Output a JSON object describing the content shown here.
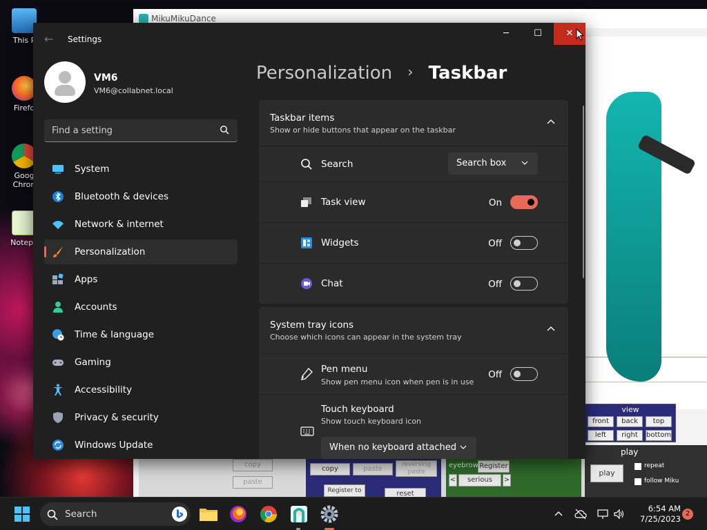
{
  "desktop": {
    "icons": [
      {
        "label": "This P",
        "color": "#4aa3e8"
      },
      {
        "label": "Firefo",
        "color": "#ff8b2c"
      },
      {
        "label": "Goog\nChron",
        "color": "#f4b400"
      },
      {
        "label": "Notepa",
        "color": "#8bc34a"
      }
    ]
  },
  "mmd": {
    "title": "MikuMikuDance",
    "buttons": {
      "copy_disabled": "copy",
      "paste_disabled": "paste",
      "reversing_paste": "reversing paste",
      "copy": "copy",
      "paste": "paste",
      "register_to": "Register to",
      "reset": "reset",
      "eyebrow": "eyebrow",
      "register": "Register",
      "serious": "serious",
      "prev": "<",
      "next": ">"
    },
    "view": {
      "title": "view",
      "front": "front",
      "back": "back",
      "top": "top",
      "left": "left",
      "right": "right",
      "bottom": "bottom"
    },
    "play": {
      "title": "play",
      "play_button": "play",
      "repeat": "repeat",
      "follow": "follow Miku"
    }
  },
  "settings": {
    "app_title": "Settings",
    "window": {
      "minimize": "─",
      "maximize": "☐",
      "close": "✕"
    },
    "profile": {
      "name": "VM6",
      "email": "VM6@collabnet.local"
    },
    "search_placeholder": "Find a setting",
    "nav": [
      {
        "label": "System",
        "icon": "monitor-icon",
        "active": false
      },
      {
        "label": "Bluetooth & devices",
        "icon": "bluetooth-icon",
        "active": false
      },
      {
        "label": "Network & internet",
        "icon": "wifi-icon",
        "active": false
      },
      {
        "label": "Personalization",
        "icon": "brush-icon",
        "active": true
      },
      {
        "label": "Apps",
        "icon": "apps-icon",
        "active": false
      },
      {
        "label": "Accounts",
        "icon": "person-icon",
        "active": false
      },
      {
        "label": "Time & language",
        "icon": "globe-clock-icon",
        "active": false
      },
      {
        "label": "Gaming",
        "icon": "gamepad-icon",
        "active": false
      },
      {
        "label": "Accessibility",
        "icon": "accessibility-icon",
        "active": false
      },
      {
        "label": "Privacy & security",
        "icon": "shield-icon",
        "active": false
      },
      {
        "label": "Windows Update",
        "icon": "update-icon",
        "active": false
      }
    ],
    "breadcrumb": {
      "parent": "Personalization",
      "separator": "›",
      "current": "Taskbar"
    },
    "taskbar_items": {
      "title": "Taskbar items",
      "description": "Show or hide buttons that appear on the taskbar",
      "search": {
        "label": "Search",
        "value": "Search box"
      },
      "task_view": {
        "label": "Task view",
        "state": "On"
      },
      "widgets": {
        "label": "Widgets",
        "state": "Off"
      },
      "chat": {
        "label": "Chat",
        "state": "Off"
      }
    },
    "system_tray": {
      "title": "System tray icons",
      "description": "Choose which icons can appear in the system tray",
      "pen_menu": {
        "label": "Pen menu",
        "description": "Show pen menu icon when pen is in use",
        "state": "Off"
      },
      "touch_keyboard": {
        "label": "Touch keyboard",
        "description": "Show touch keyboard icon",
        "value": "When no keyboard attached"
      }
    }
  },
  "taskbar": {
    "search_label": "Search",
    "time": "6:54 AM",
    "date": "7/25/2023",
    "notification_count": "2"
  },
  "colors": {
    "accent": "#e76a56",
    "close": "#c42b1c"
  }
}
